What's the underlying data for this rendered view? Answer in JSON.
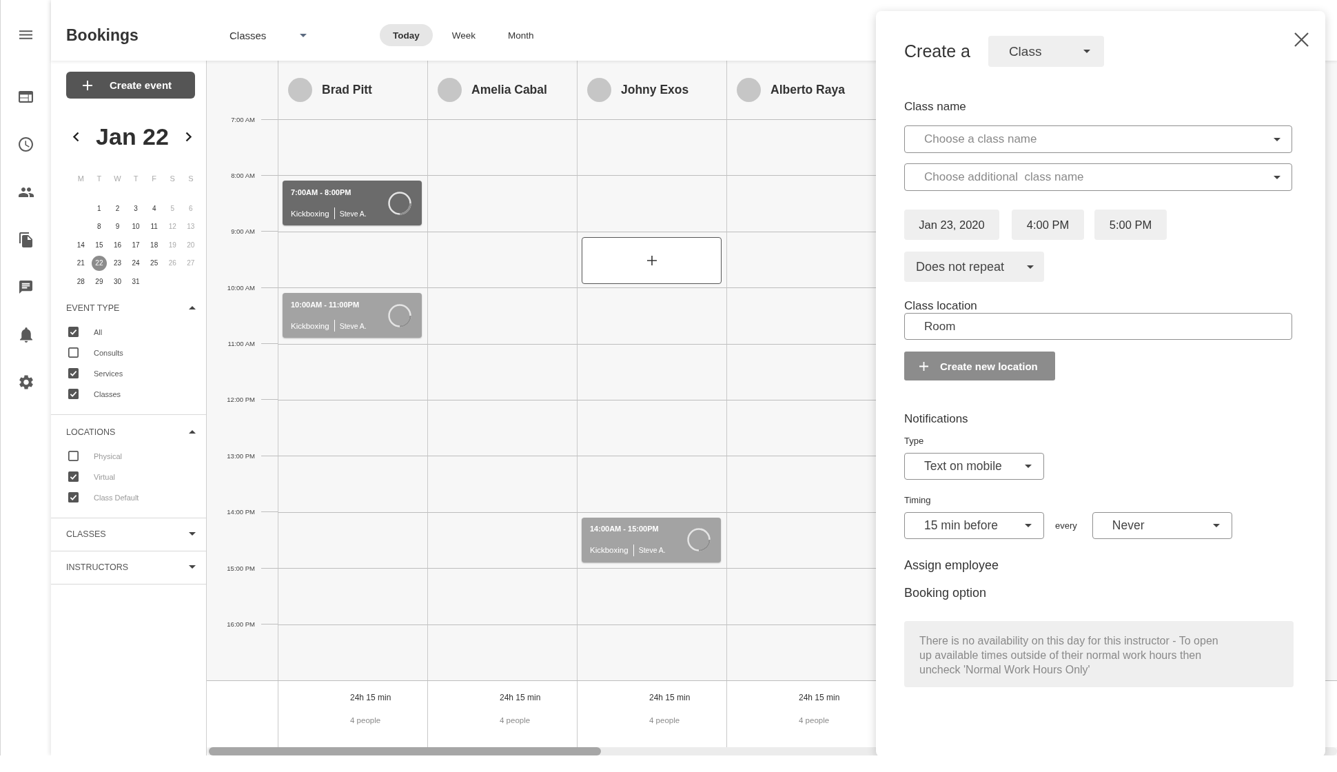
{
  "header": {
    "title": "Bookings",
    "filter_select": {
      "value": "Classes"
    },
    "views": [
      {
        "label": "Today",
        "selected": true
      },
      {
        "label": "Week",
        "selected": false
      },
      {
        "label": "Month",
        "selected": false
      }
    ]
  },
  "sidebar": {
    "create_button": "Create event",
    "calendar": {
      "title": "Jan 22",
      "weekdays": [
        "M",
        "T",
        "W",
        "T",
        "F",
        "S",
        "S"
      ],
      "weeks": [
        [
          {
            "kind": "blank"
          },
          {
            "kind": "day",
            "day": "1",
            "selected": false
          },
          {
            "kind": "day",
            "day": "2",
            "selected": false
          },
          {
            "kind": "day",
            "day": "3",
            "selected": false
          },
          {
            "kind": "day",
            "day": "4",
            "selected": false
          },
          {
            "kind": "day",
            "day": "5",
            "selected": false
          },
          {
            "kind": "day",
            "day": "6",
            "selected": false
          }
        ],
        [
          {
            "kind": "blank"
          },
          {
            "kind": "day",
            "day": "8",
            "selected": false
          },
          {
            "kind": "day",
            "day": "9",
            "selected": false
          },
          {
            "kind": "day",
            "day": "10",
            "selected": false
          },
          {
            "kind": "day",
            "day": "11",
            "selected": false
          },
          {
            "kind": "day",
            "day": "12",
            "selected": false
          },
          {
            "kind": "day",
            "day": "13",
            "selected": false
          }
        ],
        [
          {
            "kind": "day",
            "day": "14",
            "selected": false
          },
          {
            "kind": "day",
            "day": "15",
            "selected": false
          },
          {
            "kind": "day",
            "day": "16",
            "selected": false
          },
          {
            "kind": "day",
            "day": "17",
            "selected": false
          },
          {
            "kind": "day",
            "day": "18",
            "selected": false
          },
          {
            "kind": "day",
            "day": "19",
            "selected": false
          },
          {
            "kind": "day",
            "day": "20",
            "selected": false
          }
        ],
        [
          {
            "kind": "day",
            "day": "21",
            "selected": false
          },
          {
            "kind": "day",
            "day": "22",
            "selected": true
          },
          {
            "kind": "day",
            "day": "23",
            "selected": false
          },
          {
            "kind": "day",
            "day": "24",
            "selected": false
          },
          {
            "kind": "day",
            "day": "25",
            "selected": false
          },
          {
            "kind": "day",
            "day": "26",
            "selected": false
          },
          {
            "kind": "day",
            "day": "27",
            "selected": false
          }
        ],
        [
          {
            "kind": "day",
            "day": "28",
            "selected": false
          },
          {
            "kind": "day",
            "day": "29",
            "selected": false
          },
          {
            "kind": "day",
            "day": "30",
            "selected": false
          },
          {
            "kind": "day",
            "day": "31",
            "selected": false
          }
        ]
      ]
    },
    "filters": [
      {
        "title": "EVENT TYPE",
        "expanded": true,
        "options": [
          {
            "label": "All",
            "checked": true,
            "disabled": false
          },
          {
            "label": "Consults",
            "checked": false,
            "disabled": false
          },
          {
            "label": "Services",
            "checked": true,
            "disabled": false
          },
          {
            "label": "Classes",
            "checked": true,
            "disabled": false
          }
        ]
      },
      {
        "title": "LOCATIONS",
        "expanded": true,
        "options": [
          {
            "label": "Physical",
            "checked": false,
            "disabled": true
          },
          {
            "label": "Virtual",
            "checked": true,
            "disabled": true
          },
          {
            "label": "Class Default",
            "checked": true,
            "disabled": true
          }
        ]
      },
      {
        "title": "CLASSES",
        "expanded": false
      },
      {
        "title": "INSTRUCTORS",
        "expanded": false
      }
    ]
  },
  "schedule": {
    "instructors": [
      {
        "name": "Brad Pitt",
        "total": "24h 15 min",
        "people": "4 people"
      },
      {
        "name": "Amelia Cabal",
        "total": "24h 15 min",
        "people": "4 people"
      },
      {
        "name": "Johny Exos",
        "total": "24h 15 min",
        "people": "4 people"
      },
      {
        "name": "Alberto Raya",
        "total": "24h 15 min",
        "people": "4 people"
      }
    ],
    "rows": [
      {
        "time": "7:00 AM",
        "cells": [
          {
            "kind": "empty"
          },
          {
            "kind": "empty"
          },
          {
            "kind": "empty"
          },
          {
            "kind": "empty"
          }
        ]
      },
      {
        "time": "8:00 AM",
        "cells": [
          {
            "kind": "event",
            "time": "7:00AM - 8:00PM",
            "class": "Kickboxing",
            "instructor": "Steve A.",
            "color": "#6b6b6b"
          },
          {
            "kind": "empty"
          },
          {
            "kind": "empty"
          },
          {
            "kind": "empty"
          }
        ]
      },
      {
        "time": "9:00 AM",
        "cells": [
          {
            "kind": "empty"
          },
          {
            "kind": "empty"
          },
          {
            "kind": "add"
          },
          {
            "kind": "empty"
          }
        ]
      },
      {
        "time": "10:00 AM",
        "cells": [
          {
            "kind": "event",
            "time": "10:00AM - 11:00PM",
            "class": "Kickboxing",
            "instructor": "Steve A.",
            "color": "#a3a3a3"
          },
          {
            "kind": "empty"
          },
          {
            "kind": "empty"
          },
          {
            "kind": "empty"
          }
        ]
      },
      {
        "time": "11:00 AM",
        "cells": [
          {
            "kind": "empty"
          },
          {
            "kind": "empty"
          },
          {
            "kind": "empty"
          },
          {
            "kind": "empty"
          }
        ]
      },
      {
        "time": "12:00 PM",
        "cells": [
          {
            "kind": "empty"
          },
          {
            "kind": "empty"
          },
          {
            "kind": "empty"
          },
          {
            "kind": "empty"
          }
        ]
      },
      {
        "time": "13:00 PM",
        "cells": [
          {
            "kind": "empty"
          },
          {
            "kind": "empty"
          },
          {
            "kind": "empty"
          },
          {
            "kind": "empty"
          }
        ]
      },
      {
        "time": "14:00 PM",
        "cells": [
          {
            "kind": "empty"
          },
          {
            "kind": "empty"
          },
          {
            "kind": "event",
            "time": "14:00AM - 15:00PM",
            "class": "Kickboxing",
            "instructor": "Steve A.",
            "color": "#a3a3a3"
          },
          {
            "kind": "empty"
          }
        ]
      },
      {
        "time": "15:00 PM",
        "cells": [
          {
            "kind": "empty"
          },
          {
            "kind": "empty"
          },
          {
            "kind": "empty"
          },
          {
            "kind": "empty"
          }
        ]
      },
      {
        "time": "16:00 PM",
        "cells": [
          {
            "kind": "empty"
          },
          {
            "kind": "empty"
          },
          {
            "kind": "empty"
          },
          {
            "kind": "empty"
          }
        ]
      }
    ]
  },
  "create_panel": {
    "title": "Create a",
    "type_select": {
      "value": "Class"
    },
    "class_name_label": "Class name",
    "class_name_fields": [
      {
        "placeholder": "Choose a class name"
      },
      {
        "placeholder": "Choose additional  class name"
      }
    ],
    "date": {
      "value": "Jan 23, 2020"
    },
    "start_time": {
      "value": "4:00 PM"
    },
    "end_time": {
      "value": "5:00 PM"
    },
    "repeat": {
      "value": "Does not repeat"
    },
    "location_label": "Class location",
    "location_field": {
      "value": "Room"
    },
    "new_location_button": "Create new location",
    "notifications": {
      "title": "Notifications",
      "type_label": "Type",
      "type_select": {
        "value": "Text on mobile"
      },
      "timing_label": "Timing",
      "timing_select": {
        "value": "15 min before"
      },
      "every_label": "every",
      "frequency_select": {
        "value": "Never"
      }
    },
    "assign_label": "Assign employee",
    "booking_label": "Booking option",
    "notice": "There is no availability on this day for this instructor - To open up available times outside of their normal work hours then uncheck 'Normal Work Hours Only'"
  }
}
